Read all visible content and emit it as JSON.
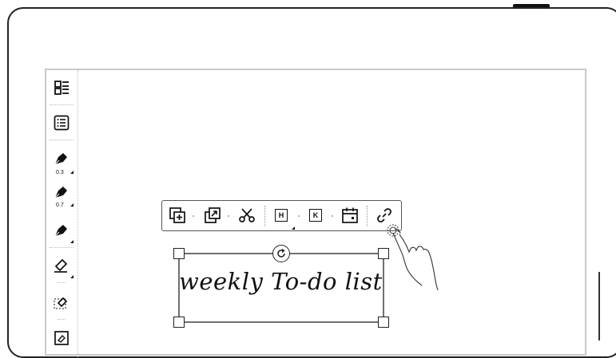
{
  "sidebar": {
    "items": [
      {
        "icon": "layers-icon"
      },
      {
        "icon": "outline-list-icon"
      },
      {
        "icon": "pen-icon",
        "size": "0.3"
      },
      {
        "icon": "pen-icon",
        "size": "0.7"
      },
      {
        "icon": "pen-icon"
      },
      {
        "icon": "eraser-icon"
      },
      {
        "icon": "lasso-eraser-icon"
      },
      {
        "icon": "eraser-alt-icon"
      }
    ]
  },
  "selection_toolbar": {
    "buttons": [
      {
        "icon": "add-to-layer-icon"
      },
      {
        "icon": "move-out-icon"
      },
      {
        "icon": "cut-icon"
      },
      {
        "icon": "heading-key-icon",
        "label": "H"
      },
      {
        "icon": "keyword-key-icon",
        "label": "K"
      },
      {
        "icon": "calendar-icon"
      },
      {
        "icon": "link-icon"
      }
    ]
  },
  "canvas": {
    "handwriting": "weekly To-do list"
  }
}
